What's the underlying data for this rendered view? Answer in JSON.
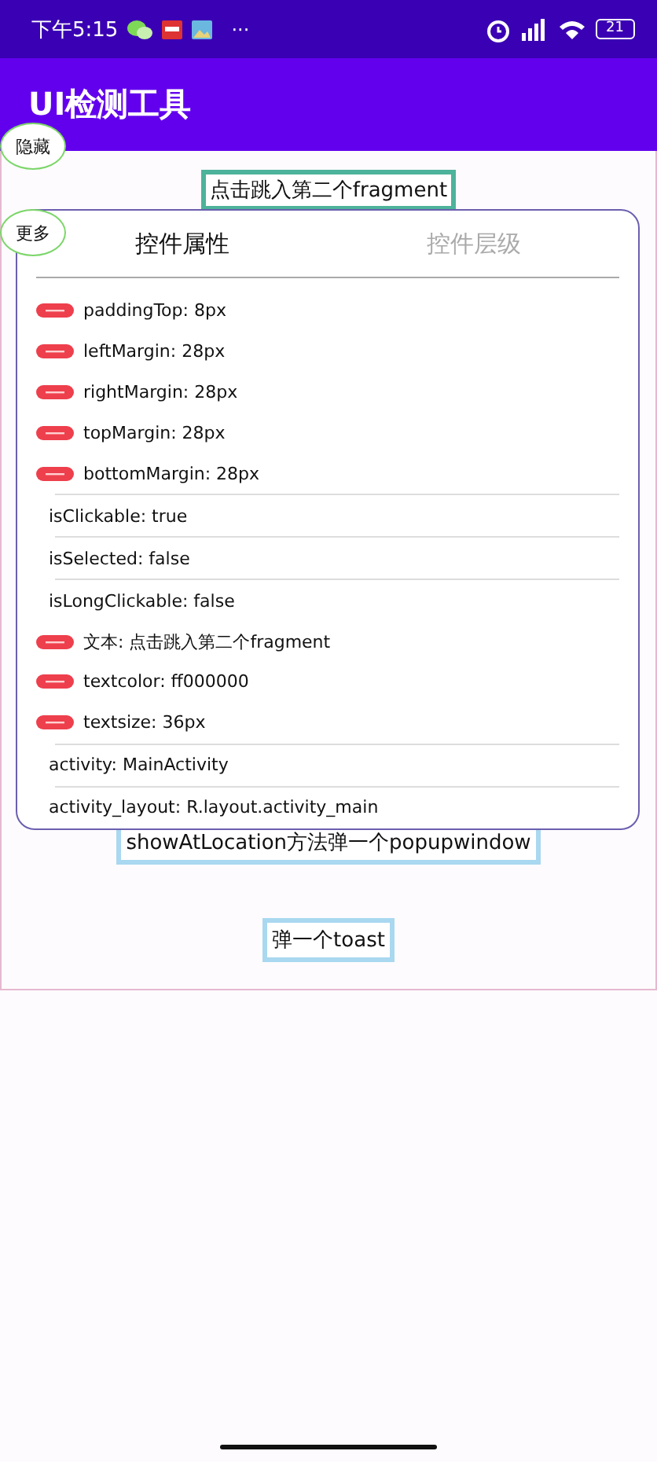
{
  "status_bar": {
    "time": "下午5:15",
    "more": "···",
    "battery": "21"
  },
  "app_bar": {
    "title": "UI检测工具"
  },
  "floating_buttons": [
    {
      "label": "隐藏"
    },
    {
      "label": "更多"
    }
  ],
  "content": {
    "fragment_button": "点击跳入第二个fragment",
    "popup_button": "showAtLocation方法弹一个popupwindow",
    "toast_button": "弹一个toast"
  },
  "panel": {
    "tabs": [
      {
        "label": "控件属性",
        "selected": true
      },
      {
        "label": "控件层级",
        "selected": false
      }
    ],
    "rows": [
      {
        "kind": "tagged",
        "text": "paddingTop: 8px"
      },
      {
        "kind": "tagged",
        "text": "leftMargin: 28px"
      },
      {
        "kind": "tagged",
        "text": "rightMargin: 28px"
      },
      {
        "kind": "tagged",
        "text": "topMargin: 28px"
      },
      {
        "kind": "tagged",
        "text": "bottomMargin: 28px"
      },
      {
        "kind": "plain",
        "text": "isClickable: true"
      },
      {
        "kind": "plain",
        "text": "isSelected: false"
      },
      {
        "kind": "plain",
        "text": "isLongClickable: false"
      },
      {
        "kind": "tagged",
        "text": "文本: 点击跳入第二个fragment"
      },
      {
        "kind": "tagged",
        "text": "textcolor: ff000000"
      },
      {
        "kind": "tagged",
        "text": "textsize: 36px"
      },
      {
        "kind": "plain",
        "text": "activity: MainActivity"
      },
      {
        "kind": "plain",
        "text": "activity_layout: R.layout.activity_main"
      }
    ]
  }
}
